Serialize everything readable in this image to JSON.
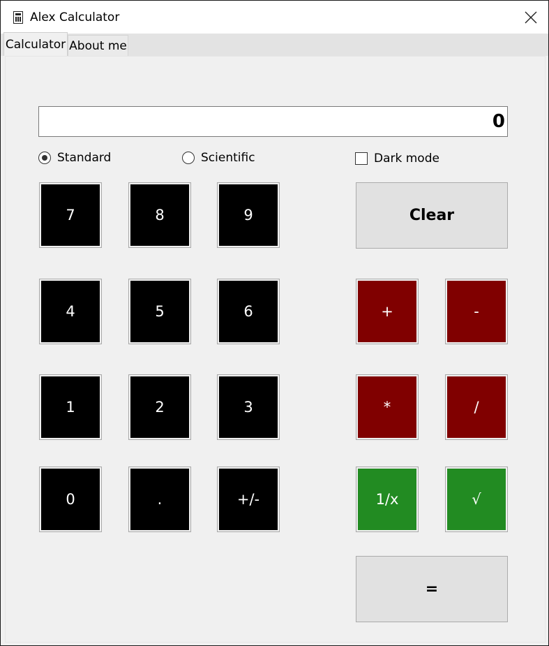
{
  "window": {
    "title": "Alex Calculator",
    "icon": "calculator-icon"
  },
  "tabs": [
    {
      "label": "Calculator",
      "active": true
    },
    {
      "label": "About me",
      "active": false
    }
  ],
  "display": {
    "value": "0"
  },
  "modes": {
    "standard": "Standard",
    "scientific": "Scientific",
    "selected": "Standard"
  },
  "dark_mode": {
    "label": "Dark mode",
    "checked": false
  },
  "keys": {
    "seven": "7",
    "eight": "8",
    "nine": "9",
    "four": "4",
    "five": "5",
    "six": "6",
    "one": "1",
    "two": "2",
    "three": "3",
    "zero": "0",
    "dot": ".",
    "negate": "+/-",
    "clear": "Clear",
    "plus": "+",
    "minus": "-",
    "multiply": "*",
    "divide": "/",
    "reciprocal": "1/x",
    "sqrt": "√",
    "equals": "="
  },
  "colors": {
    "digit_bg": "#000000",
    "operator_bg": "#800000",
    "function_bg": "#228b22",
    "action_bg": "#e1e1e1"
  }
}
